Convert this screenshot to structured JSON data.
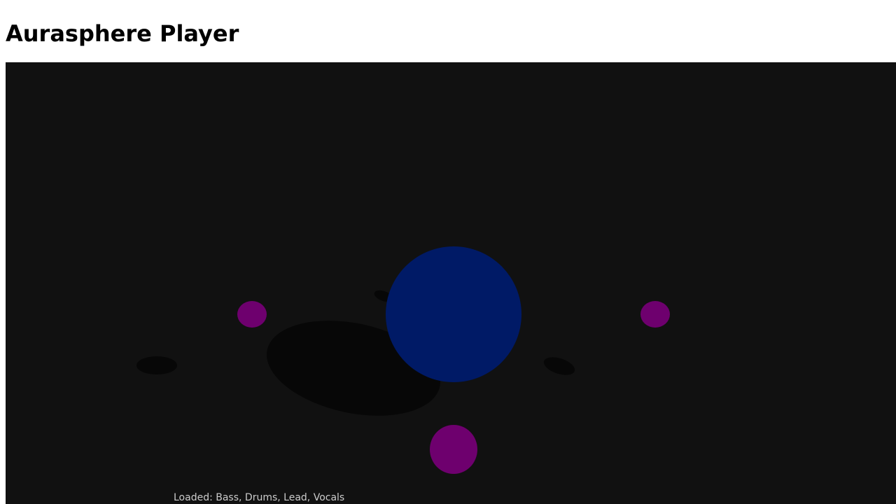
{
  "app": {
    "title": "Aurasphere Player"
  },
  "scene": {
    "status_text": "Loaded: Bass, Drums, Lead, Vocals",
    "background_color": "#111111",
    "center_sphere_color": "#001a66",
    "track_node_color": "#6e006e",
    "shadow_color": "#070707"
  }
}
